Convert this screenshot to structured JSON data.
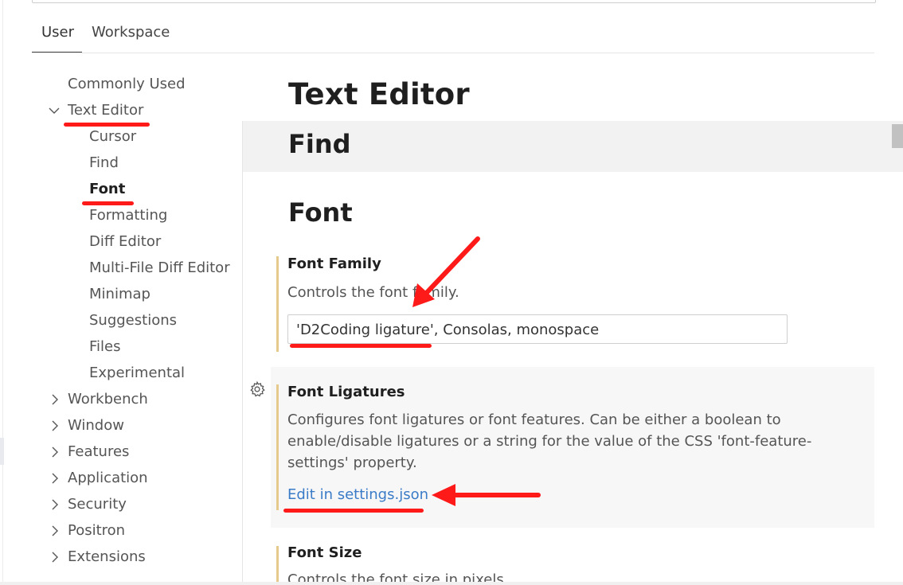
{
  "tabs": [
    {
      "label": "User"
    },
    {
      "label": "Workspace"
    }
  ],
  "tree": {
    "commonly_used": "Commonly Used",
    "text_editor": "Text Editor",
    "text_editor_children": [
      "Cursor",
      "Find",
      "Font",
      "Formatting",
      "Diff Editor",
      "Multi-File Diff Editor",
      "Minimap",
      "Suggestions",
      "Files",
      "Experimental"
    ],
    "collapsed": [
      "Workbench",
      "Window",
      "Features",
      "Application",
      "Security",
      "Positron",
      "Extensions"
    ]
  },
  "content": {
    "section_title": "Text Editor",
    "find_title": "Find",
    "font_title": "Font",
    "font_family": {
      "title": "Font Family",
      "description": "Controls the font family.",
      "value": "'D2Coding ligature', Consolas, monospace"
    },
    "font_ligatures": {
      "title": "Font Ligatures",
      "description": "Configures font ligatures or font features. Can be either a boolean to enable/disable ligatures or a string for the value of the CSS 'font-feature-settings' property.",
      "link": "Edit in settings.json"
    },
    "font_size": {
      "title": "Font Size",
      "description": "Controls the font size in pixels."
    }
  },
  "icons": {
    "expanded": "chevron-down-icon",
    "collapsed": "chevron-right-icon",
    "settings": "gear-icon"
  },
  "colors": {
    "link": "#3a7bc8",
    "modified_bar": "#e6c98c",
    "annotation": "#ff1a1a"
  }
}
